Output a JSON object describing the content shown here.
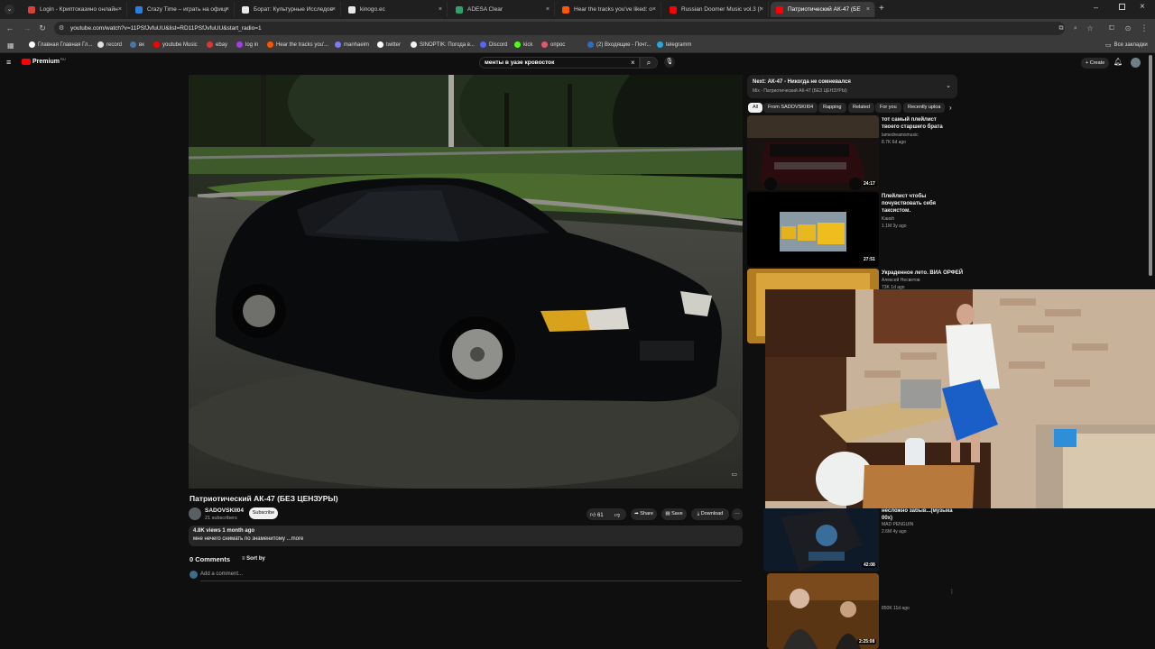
{
  "browser": {
    "tabs": [
      {
        "label": "Login - Криптоказино онлайн",
        "color": "#d6413a"
      },
      {
        "label": "Crazy Time – играть на офици",
        "color": "#2f7de1"
      },
      {
        "label": "Борат: Культурные Исследова",
        "color": "#e8e8e8"
      },
      {
        "label": "kinogo.ec",
        "color": "#e8e8e8"
      },
      {
        "label": "ADESA Clear",
        "color": "#2fa06a"
      },
      {
        "label": "Hear the tracks you've liked: o",
        "color": "#ff5500"
      },
      {
        "label": "Russian Doomer Music vol.3 (S",
        "color": "#ff0000"
      },
      {
        "label": "Патриотический АК-47 (БЕ",
        "color": "#ff0000"
      }
    ],
    "url": "youtube.com/watch?v=11PSfJvfuUU&list=RD11PSfJvfuUU&start_radio=1",
    "bookmarks": [
      "Главная Главная Гл...",
      "record",
      "вк",
      "youtube Music",
      "ebay",
      "log in",
      "Hear the tracks you'...",
      "manhaeim",
      "twitter",
      "SINOPTIK: Погода в...",
      "Discord",
      "kick",
      "опрос",
      "(2) Входящие - Почт...",
      "telegramm"
    ],
    "all_bookmarks": "Все закладки"
  },
  "youtube": {
    "logo": "Premium",
    "logo_badge": "RU",
    "search_query": "менты в уазе кровосток",
    "create_label": "Create",
    "video": {
      "title": "Патриотический АК-47 (БЕЗ ЦЕНЗУРЫ)",
      "channel": "SADOVSKII04",
      "subscribers": "21 subscribers",
      "subscribe_label": "Subscribe",
      "likes": "61",
      "share": "Share",
      "save": "Save",
      "download": "Download",
      "views_date": "4.8K views  1 month ago",
      "description": "мне нечего снимать по знаменитому ...more",
      "comments": "0 Comments",
      "sort_by": "Sort by",
      "add_comment": "Add a comment..."
    },
    "next": {
      "title": "Next: АК-47 - Никогда не сомневался",
      "subtitle": "Mix - Патриотический АК-47 (БЕЗ ЦЕНЗУРЫ)"
    },
    "chips": [
      "All",
      "From SADOVSKII04",
      "Rapping",
      "Related",
      "For you",
      "Recently uploa"
    ],
    "recommendations": [
      {
        "title": "тот самый плейлист твоего старшего брата",
        "channel": "lamedreamsmusic",
        "meta": "8.7K  6d ago",
        "duration": "24:17"
      },
      {
        "title": "Плейлист чтобы почувствовать себя таксистом.",
        "channel": "Kaиsh",
        "meta": "1.1M  3y ago",
        "duration": "27:51"
      },
      {
        "title": "Украденное лето. ВИА ОРФЕЙ",
        "channel": "Алексей Несветов",
        "meta": "73K  1d ago",
        "duration": ""
      },
      {
        "title": "несложно забыв...(музыка 00х)",
        "channel": "MAD PENGUIN",
        "meta": "2.6M  4y ago",
        "duration": "42:08"
      },
      {
        "title": "",
        "channel": "",
        "meta": "850K  11d ago",
        "duration": "2:25:08"
      }
    ]
  }
}
